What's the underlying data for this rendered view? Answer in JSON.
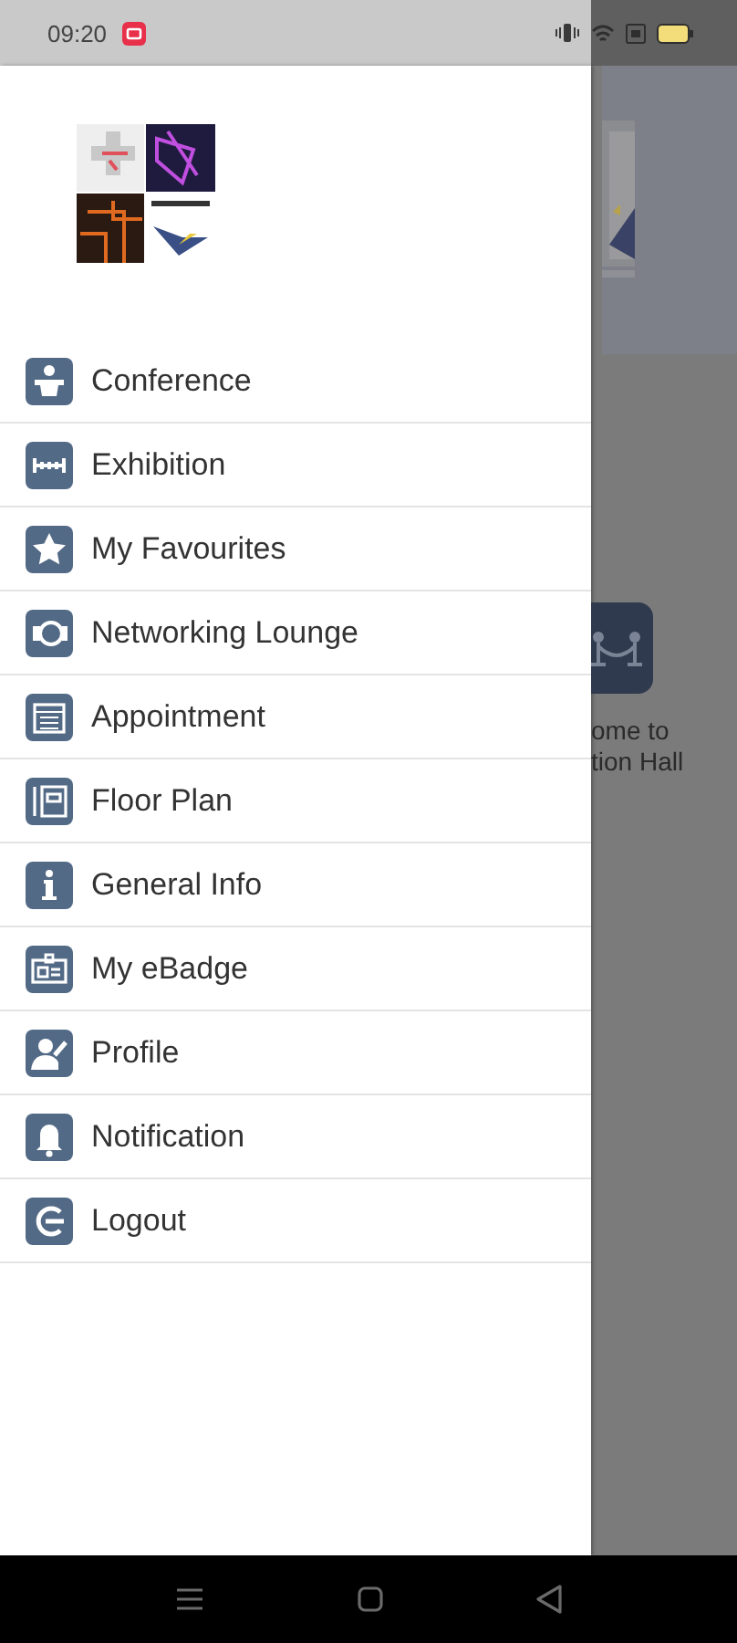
{
  "status_bar": {
    "time": "09:20"
  },
  "drawer": {
    "menu": [
      {
        "label": "Conference"
      },
      {
        "label": "Exhibition"
      },
      {
        "label": "My Favourites"
      },
      {
        "label": "Networking Lounge"
      },
      {
        "label": "Appointment"
      },
      {
        "label": "Floor Plan"
      },
      {
        "label": "General Info"
      },
      {
        "label": "My eBadge"
      },
      {
        "label": "Profile"
      },
      {
        "label": "Notification"
      },
      {
        "label": "Logout"
      }
    ]
  },
  "background_page": {
    "welcome_lines": [
      "ome to",
      "tion Hall"
    ]
  }
}
